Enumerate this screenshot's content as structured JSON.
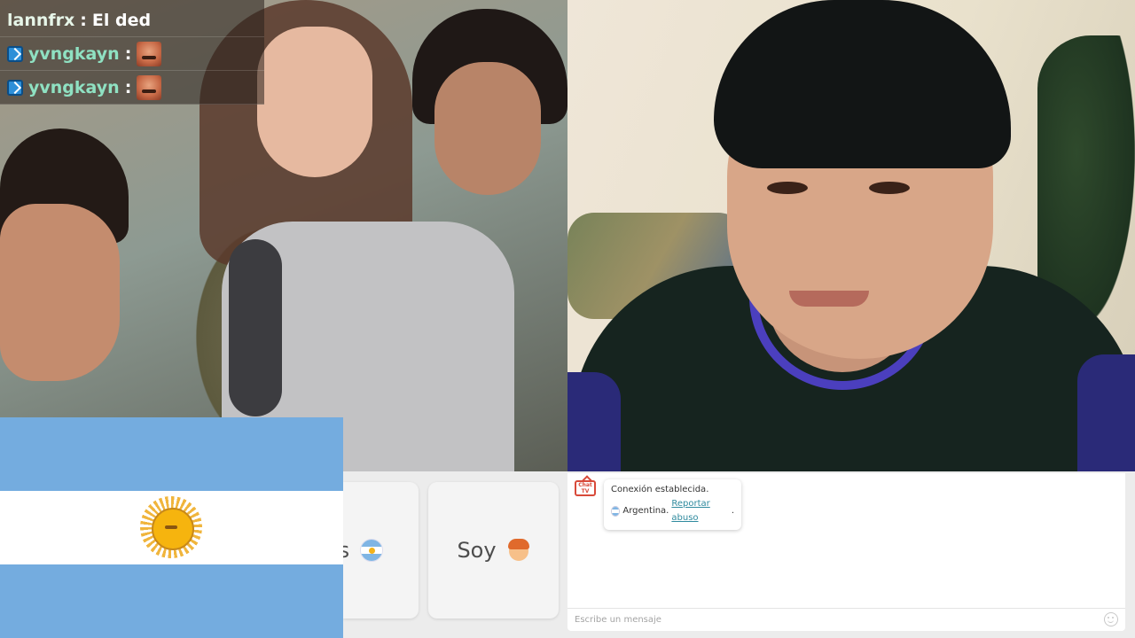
{
  "overlay_chat": [
    {
      "user": "lannfrx",
      "separator": ":",
      "message": "El ded",
      "badge": null
    },
    {
      "user": "yvngkayn",
      "separator": ":",
      "message": "",
      "badge": "rank-icon",
      "emote": "emote"
    },
    {
      "user": "yvngkayn",
      "separator": ":",
      "message": "",
      "badge": "rank-icon",
      "emote": "emote"
    }
  ],
  "flag": {
    "country": "Argentina",
    "colors": {
      "celeste": "#74acdf",
      "white": "#ffffff",
      "sun": "#f6b40e"
    }
  },
  "cards": {
    "pais_text": "ís",
    "soy_text": "Soy"
  },
  "chat": {
    "logo_text": "Chat TV",
    "system_message": "Conexión establecida.",
    "country_label": "Argentina.",
    "report_link": "Reportar abuso",
    "report_suffix": ".",
    "input_placeholder": "Escribe un mensaje"
  }
}
